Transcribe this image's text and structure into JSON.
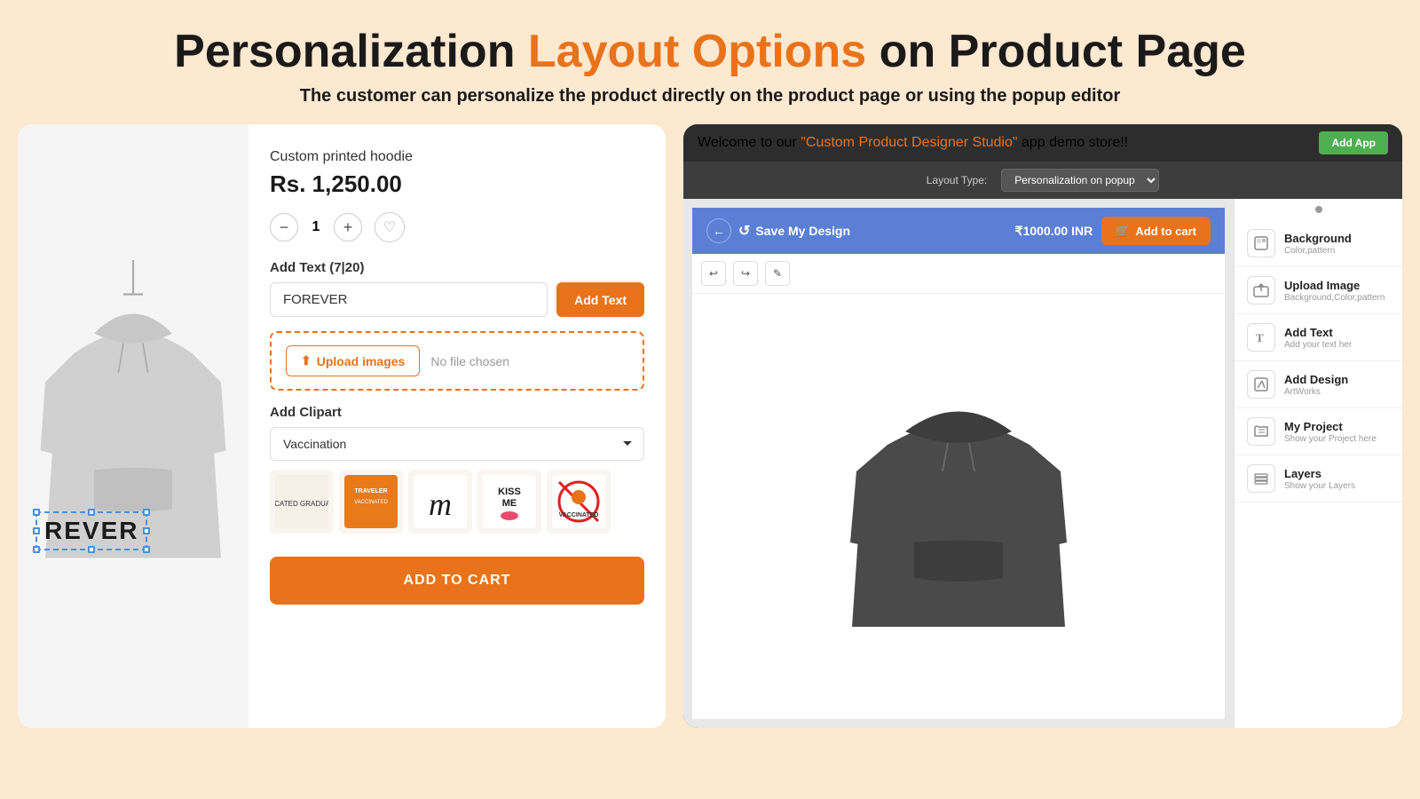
{
  "header": {
    "title_part1": "Personalization ",
    "title_part2": "Layout Options",
    "title_part3": " on Product Page",
    "subtitle": "The customer can personalize the product directly on the product page or using the popup editor"
  },
  "product_panel": {
    "product_name": "Custom printed hoodie",
    "price": "Rs. 1,250.00",
    "quantity": "1",
    "add_text_label": "Add Text (7|20)",
    "text_input_value": "FOREVER",
    "text_input_placeholder": "",
    "add_text_button": "Add Text",
    "upload_button": "Upload images",
    "no_file_text": "No file chosen",
    "clipart_label": "Add Clipart",
    "clipart_dropdown_value": "Vaccination",
    "add_to_cart_button": "ADD TO CART"
  },
  "popup_panel": {
    "topbar_text1": "Welcome to our ",
    "topbar_highlight": "\"Custom Product Designer Studio\"",
    "topbar_text2": " app demo store!!",
    "add_app_button": "Add App",
    "layout_type_label": "Layout Type:",
    "layout_select_value": "Personalization on popup",
    "save_design_label": "Save My Design",
    "price_label": "₹1000.00 INR",
    "add_to_cart_label": "Add to cart",
    "sidebar_items": [
      {
        "title": "Background",
        "subtitle": "Color,pattern",
        "icon": "🎨"
      },
      {
        "title": "Upload Image",
        "subtitle": "Background,Color,pattern",
        "icon": "🖼"
      },
      {
        "title": "Add Text",
        "subtitle": "Add your text her",
        "icon": "T"
      },
      {
        "title": "Add Design",
        "subtitle": "ArtWorks",
        "icon": "✏"
      },
      {
        "title": "My Project",
        "subtitle": "Show your Project here",
        "icon": "📁"
      },
      {
        "title": "Layers",
        "subtitle": "Show your Layers",
        "icon": "📄"
      }
    ]
  }
}
